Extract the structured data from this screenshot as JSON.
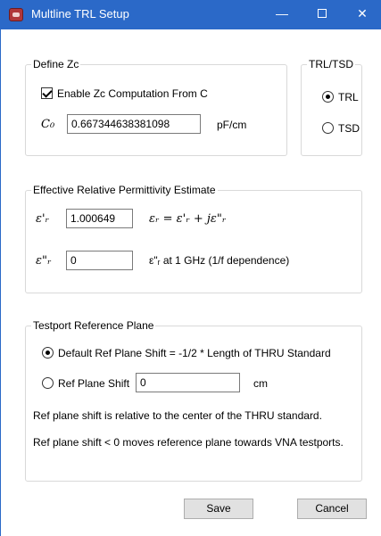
{
  "window": {
    "title": "Multline TRL Setup",
    "controls": {
      "minimize": "—",
      "close": "✕"
    }
  },
  "define_zc": {
    "legend": "Define Zc",
    "enable_label": "Enable Zc Computation From C",
    "enable_checked": true,
    "c0_label": "C₀",
    "c0_value": "0.667344638381098",
    "c0_unit": "pF/cm"
  },
  "trl_tsd": {
    "legend": "TRL/TSD",
    "options": [
      "TRL",
      "TSD"
    ],
    "selected": "TRL"
  },
  "permittivity": {
    "legend": "Effective Relative Permittivity Estimate",
    "eps_real_label": "ε'ᵣ",
    "eps_real_value": "1.000649",
    "eps_real_note": "εᵣ = ε'ᵣ + jε\"ᵣ",
    "eps_imag_label": "ε\"ᵣ",
    "eps_imag_value": "0",
    "eps_imag_note": "ε\"ᵣ at 1 GHz (1/f dependence)"
  },
  "testport": {
    "legend": "Testport Reference Plane",
    "default_option": "Default Ref Plane Shift = -1/2 * Length of THRU Standard",
    "default_selected": true,
    "custom_option": "Ref Plane Shift",
    "custom_value": "0",
    "custom_unit": "cm",
    "note1": "Ref plane shift is relative to the center of the THRU standard.",
    "note2": "Ref plane shift < 0 moves reference plane towards VNA testports."
  },
  "buttons": {
    "save": "Save",
    "cancel": "Cancel"
  }
}
